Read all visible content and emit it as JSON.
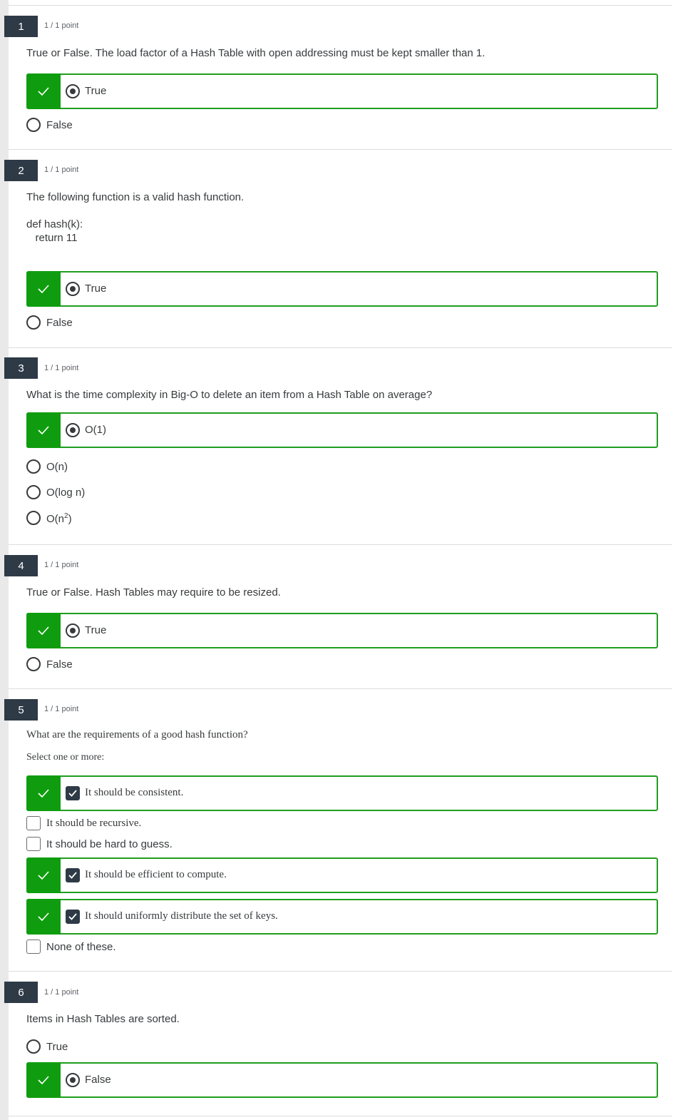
{
  "colors": {
    "correct_green": "#0f9d0f",
    "badge_dark": "#2e3a46"
  },
  "icons": {
    "correct": "check-icon",
    "selected_radio": "radio-selected-icon",
    "checked_box": "checkbox-checked-icon"
  },
  "questions": [
    {
      "number": "1",
      "points": "1 / 1 point",
      "text": "True or False. The load factor of a Hash Table with open addressing must be kept smaller than 1.",
      "options": [
        {
          "label": "True",
          "selected": true,
          "correct": true
        },
        {
          "label": "False",
          "selected": false,
          "correct": false
        }
      ]
    },
    {
      "number": "2",
      "points": "1 / 1 point",
      "text": "The following function is a valid hash function.",
      "code": "def hash(k):\n   return 11",
      "options": [
        {
          "label": "True",
          "selected": true,
          "correct": true
        },
        {
          "label": "False",
          "selected": false,
          "correct": false
        }
      ]
    },
    {
      "number": "3",
      "points": "1 / 1 point",
      "text": "What is the time complexity in Big-O to delete an item from a Hash Table on average?",
      "options": [
        {
          "label": "O(1)",
          "selected": true,
          "correct": true
        },
        {
          "label": "O(n)",
          "selected": false,
          "correct": false
        },
        {
          "label": "O(log n)",
          "selected": false,
          "correct": false
        },
        {
          "label_base": "O(n",
          "label_sup": "2",
          "label_end": ")",
          "selected": false,
          "correct": false
        }
      ]
    },
    {
      "number": "4",
      "points": "1 / 1 point",
      "text": "True or False. Hash Tables may require to be resized.",
      "options": [
        {
          "label": "True",
          "selected": true,
          "correct": true
        },
        {
          "label": "False",
          "selected": false,
          "correct": false
        }
      ]
    },
    {
      "number": "5",
      "points": "1 / 1 point",
      "text": "What are the requirements of a good hash function?",
      "subtext": "Select one or more:",
      "options": [
        {
          "label": "It should be consistent.",
          "selected": true,
          "correct": true
        },
        {
          "label": "It should be recursive.",
          "selected": false,
          "correct": false
        },
        {
          "label": "It should be hard to guess.",
          "selected": false,
          "correct": false
        },
        {
          "label": "It should be efficient to compute.",
          "selected": true,
          "correct": true
        },
        {
          "label": "It should uniformly distribute the set of keys.",
          "selected": true,
          "correct": true
        },
        {
          "label": "None of these.",
          "selected": false,
          "correct": false
        }
      ]
    },
    {
      "number": "6",
      "points": "1 / 1 point",
      "text": "Items in Hash Tables are sorted.",
      "options": [
        {
          "label": "True",
          "selected": false,
          "correct": false
        },
        {
          "label": "False",
          "selected": true,
          "correct": true
        }
      ]
    }
  ]
}
